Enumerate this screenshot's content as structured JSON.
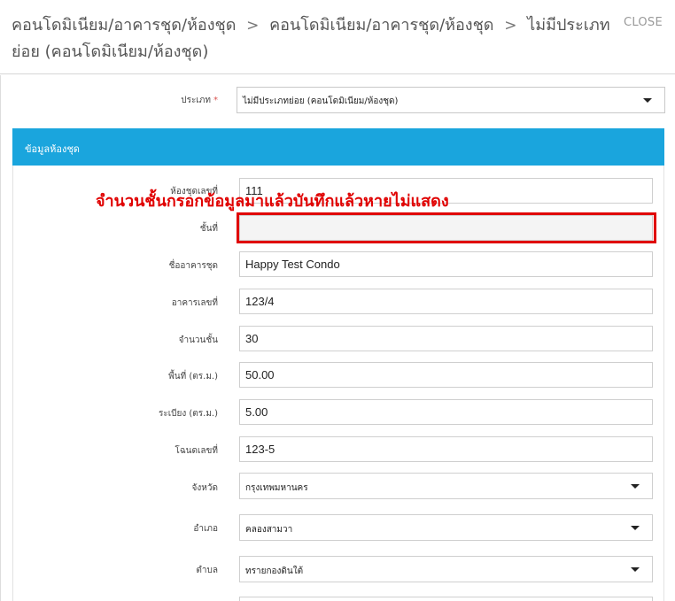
{
  "header": {
    "crumb1": "คอนโดมิเนียม/อาคารชุด/ห้องชุด",
    "crumb2": "คอนโดมิเนียม/อาคารชุด/ห้องชุด",
    "crumb3": "ไม่มีประเภทย่อย (คอนโดมิเนียม/ห้องชุด)",
    "separator": ">",
    "close_label": "CLOSE"
  },
  "type_field": {
    "label": "ประเภท",
    "required_mark": "*",
    "value": "ไม่มีประเภทย่อย (คอนโดมิเนียม/ห้องชุด)"
  },
  "section": {
    "title": "ข้อมูลห้องชุด"
  },
  "annotation": {
    "text": "จำนวนชั้นกรอกข้อมูลมาแล้วบันทึกแล้วหายไม่แสดง",
    "color": "#e00000"
  },
  "fields": {
    "room_no": {
      "label": "ห้องชุดเลขที่",
      "value": "111"
    },
    "floor": {
      "label": "ชั้นที่",
      "value": ""
    },
    "building_name": {
      "label": "ชื่ออาคารชุด",
      "value": "Happy Test Condo"
    },
    "building_no": {
      "label": "อาคารเลขที่",
      "value": "123/4"
    },
    "floor_count": {
      "label": "จำนวนชั้น",
      "value": "30"
    },
    "area": {
      "label": "พื้นที่ (ตร.ม.)",
      "value": "50.00"
    },
    "balcony": {
      "label": "ระเบียง (ตร.ม.)",
      "value": "5.00"
    },
    "deed_no": {
      "label": "โฉนดเลขที่",
      "value": "123-5"
    },
    "province": {
      "label": "จังหวัด",
      "value": "กรุงเทพมหานคร"
    },
    "district": {
      "label": "อำเภอ",
      "value": "คลองสามวา"
    },
    "subdistrict": {
      "label": "ตำบล",
      "value": "ทรายกองดินใต้"
    }
  },
  "colors": {
    "section_bar": "#1aa5dd",
    "highlight": "#e00000"
  }
}
